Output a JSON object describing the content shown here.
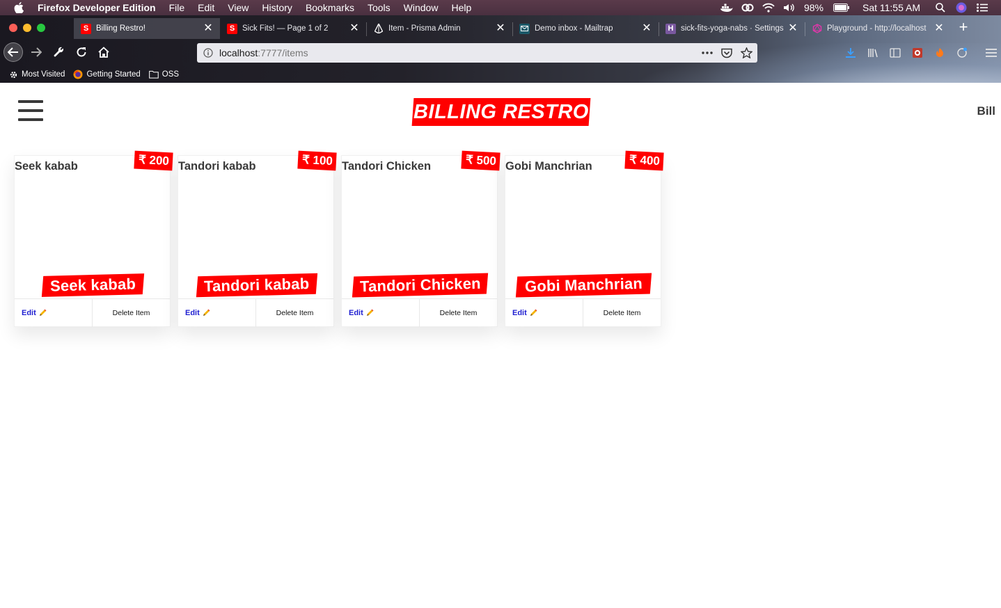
{
  "menubar": {
    "app": "Firefox Developer Edition",
    "items": [
      "File",
      "Edit",
      "View",
      "History",
      "Bookmarks",
      "Tools",
      "Window",
      "Help"
    ],
    "battery": "98%",
    "clock": "Sat 11:55 AM"
  },
  "tabs": [
    {
      "label": "Billing Restro!",
      "favicon": "S",
      "favicon_color": "#ff0000"
    },
    {
      "label": "Sick Fits! — Page 1 of 2",
      "favicon": "S",
      "favicon_color": "#ff0000"
    },
    {
      "label": "Item - Prisma Admin",
      "favicon": "",
      "favicon_color": ""
    },
    {
      "label": "Demo inbox - Mailtrap",
      "favicon": "",
      "favicon_color": "#1c5a6a"
    },
    {
      "label": "sick-fits-yoga-nabs · Settings",
      "favicon": "H",
      "favicon_color": "#79589f"
    },
    {
      "label": "Playground - http://localhost",
      "favicon": "",
      "favicon_color": "#e535ab"
    }
  ],
  "url": {
    "host": "localhost",
    "path": ":7777/items"
  },
  "bookmarks": [
    "Most Visited",
    "Getting Started",
    "OSS"
  ],
  "site": {
    "logo": "BILLING RESTRO",
    "nav_bill": "Bill",
    "brand_color": "#ff0000"
  },
  "items": [
    {
      "title": "Seek kabab",
      "price": "₹ 200",
      "edit": "Edit",
      "delete": "Delete Item"
    },
    {
      "title": "Tandori kabab",
      "price": "₹ 100",
      "edit": "Edit",
      "delete": "Delete Item"
    },
    {
      "title": "Tandori Chicken",
      "price": "₹ 500",
      "edit": "Edit",
      "delete": "Delete Item"
    },
    {
      "title": "Gobi Manchrian",
      "price": "₹ 400",
      "edit": "Edit",
      "delete": "Delete Item"
    }
  ]
}
